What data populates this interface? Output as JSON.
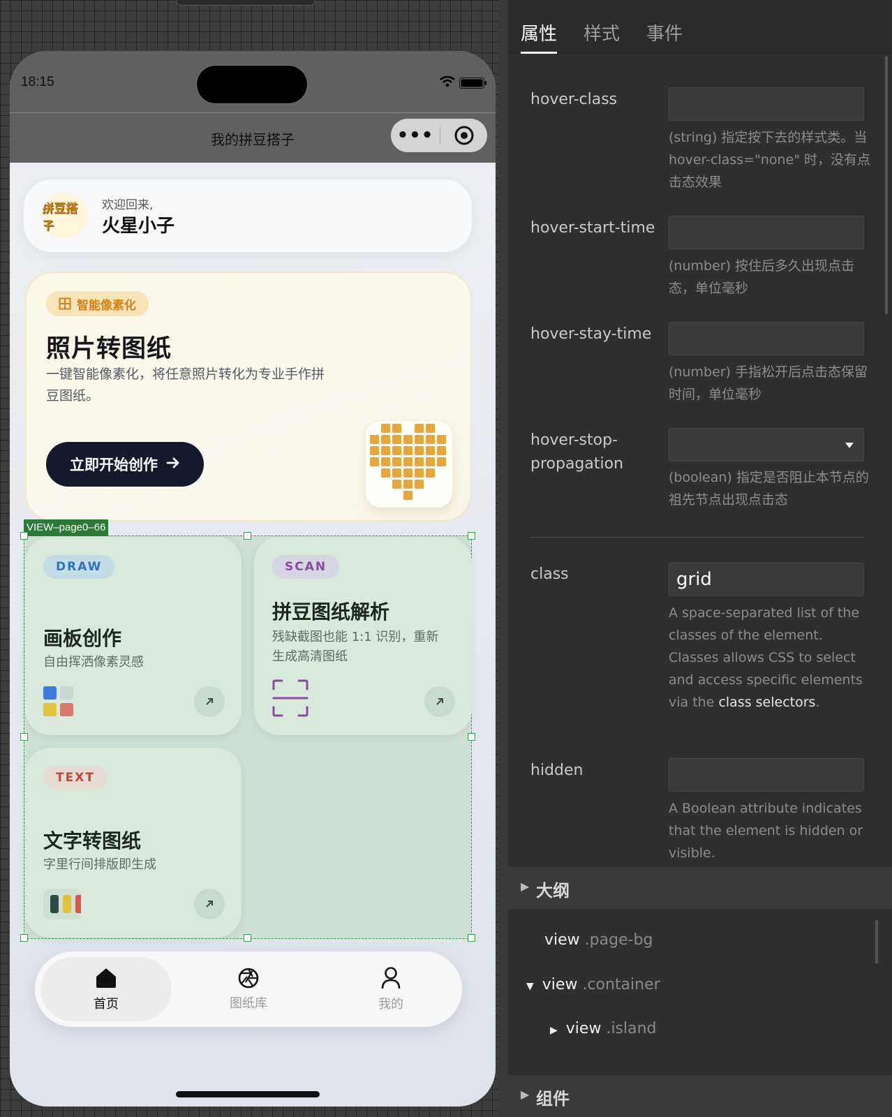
{
  "phone": {
    "status_time": "18:15",
    "nav_title": "我的拼豆搭子",
    "capsule_more": "•••",
    "user": {
      "avatar_text": "拼豆搭子",
      "welcome": "欢迎回来,",
      "name": "火星小子"
    },
    "hero": {
      "badge": "智能像素化",
      "title": "照片转图纸",
      "desc": "一键智能像素化，将任意照片转化为专业手作拼豆图纸。",
      "button": "立即开始创作"
    },
    "grid_label": "VIEW–page0–66",
    "cards": [
      {
        "tag": "DRAW",
        "tag_color": "#2f73c0",
        "tag_bg": "#c4dce4",
        "title": "画板创作",
        "subtitle": "自由挥洒像素灵感",
        "icon": "color-swatch-icon"
      },
      {
        "tag": "SCAN",
        "tag_color": "#8a4aa2",
        "tag_bg": "#d6d6e2",
        "title": "拼豆图纸解析",
        "subtitle": "残缺截图也能 1:1 识别，重新生成高清图纸",
        "icon": "scan-frame-icon"
      },
      {
        "tag": "TEXT",
        "tag_color": "#c0463a",
        "tag_bg": "#e7dcd4",
        "title": "文字转图纸",
        "subtitle": "字里行间排版即生成",
        "icon": "color-bars-icon"
      }
    ],
    "tabbar": [
      {
        "label": "首页",
        "icon": "home-icon",
        "active": true
      },
      {
        "label": "图纸库",
        "icon": "aperture-icon",
        "active": false
      },
      {
        "label": "我的",
        "icon": "user-icon",
        "active": false
      }
    ]
  },
  "panel": {
    "tabs": [
      "属性",
      "样式",
      "事件"
    ],
    "props": [
      {
        "label": "hover-class",
        "value": "",
        "desc": "(string) 指定按下去的样式类。当 hover-class=\"none\" 时，没有点击态效果"
      },
      {
        "label": "hover-start-time",
        "value": "",
        "desc": "(number) 按住后多久出现点击态，单位毫秒"
      },
      {
        "label": "hover-stay-time",
        "value": "",
        "desc": "(number) 手指松开后点击态保留时间，单位毫秒"
      },
      {
        "label": "hover-stop-propagation",
        "value": "",
        "desc": "(boolean) 指定是否阻止本节点的祖先节点出现点击态"
      },
      {
        "label": "class",
        "value": "grid",
        "desc": "A space-separated list of the classes of the element. Classes allows CSS to select and access specific elements via the",
        "desc_link": "class selectors",
        "desc_end": "."
      },
      {
        "label": "hidden",
        "value": "",
        "desc": "A Boolean attribute indicates that the element is hidden or visible."
      }
    ],
    "outline": {
      "title": "大纲",
      "rows": [
        {
          "tag": "view",
          "cls": ".page-bg"
        },
        {
          "tag": "view",
          "cls": ".container"
        },
        {
          "tag": "view",
          "cls": ".island"
        }
      ]
    },
    "components_title": "组件"
  }
}
